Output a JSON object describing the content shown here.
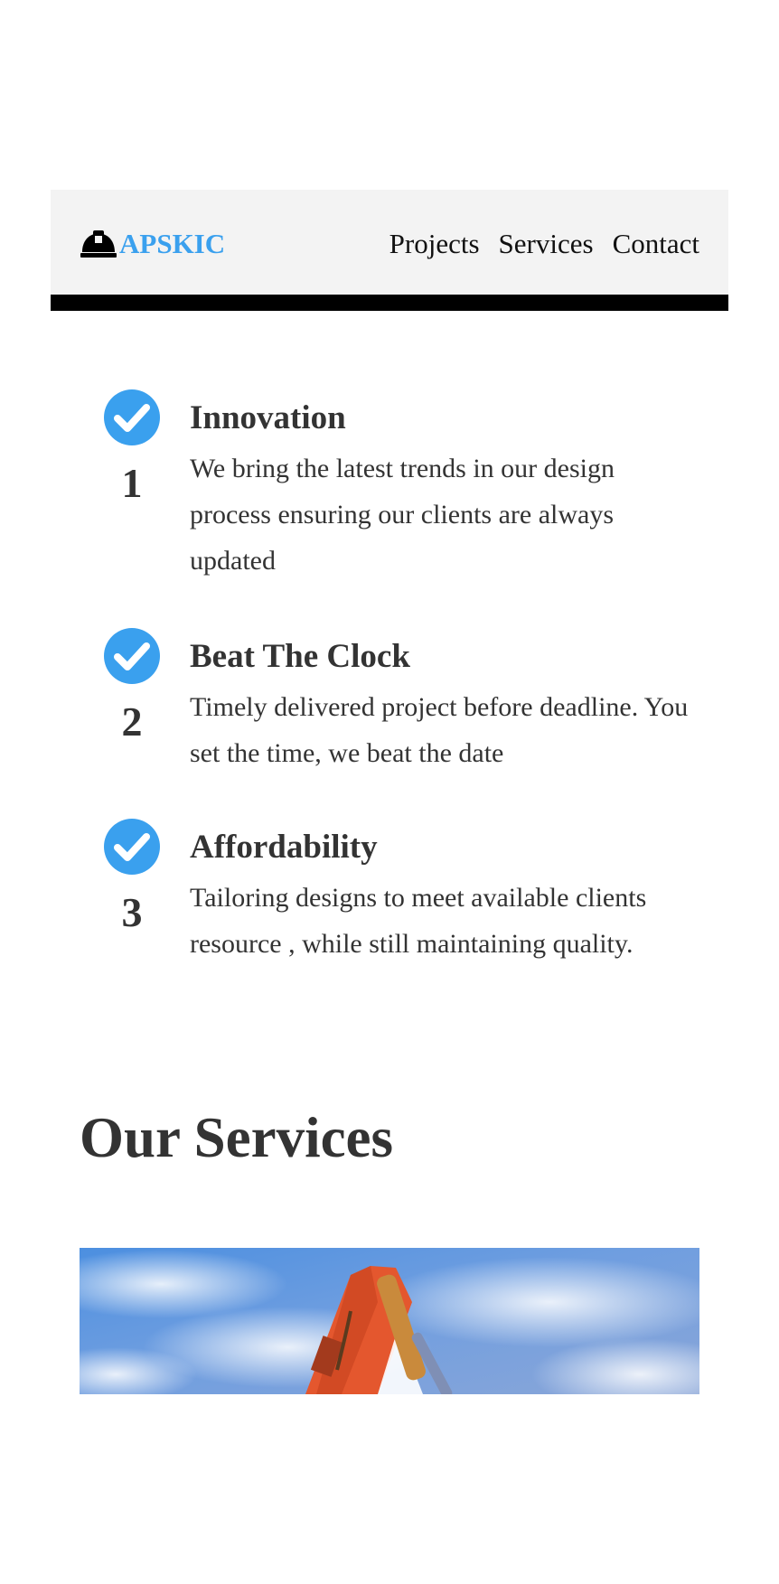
{
  "nav": {
    "brand": "APSKIC",
    "links": [
      "Projects",
      "Services",
      "Contact"
    ]
  },
  "features": [
    {
      "number": "1",
      "title": "Innovation",
      "text": "We bring the latest trends in our design process ensuring our clients are always updated"
    },
    {
      "number": "2",
      "title": "Beat The Clock",
      "text": "Timely delivered project before deadline. You set the time, we beat the date"
    },
    {
      "number": "3",
      "title": "Affordability",
      "text": "Tailoring designs to meet available clients resource , while still maintaining quality."
    }
  ],
  "services": {
    "title": "Our Services"
  },
  "colors": {
    "accent": "#3aa0ee",
    "text": "#333333",
    "navbar_bg": "#f3f3f3"
  },
  "icons": {
    "brand": "hard-hat-icon",
    "feature": "check-circle-icon"
  }
}
